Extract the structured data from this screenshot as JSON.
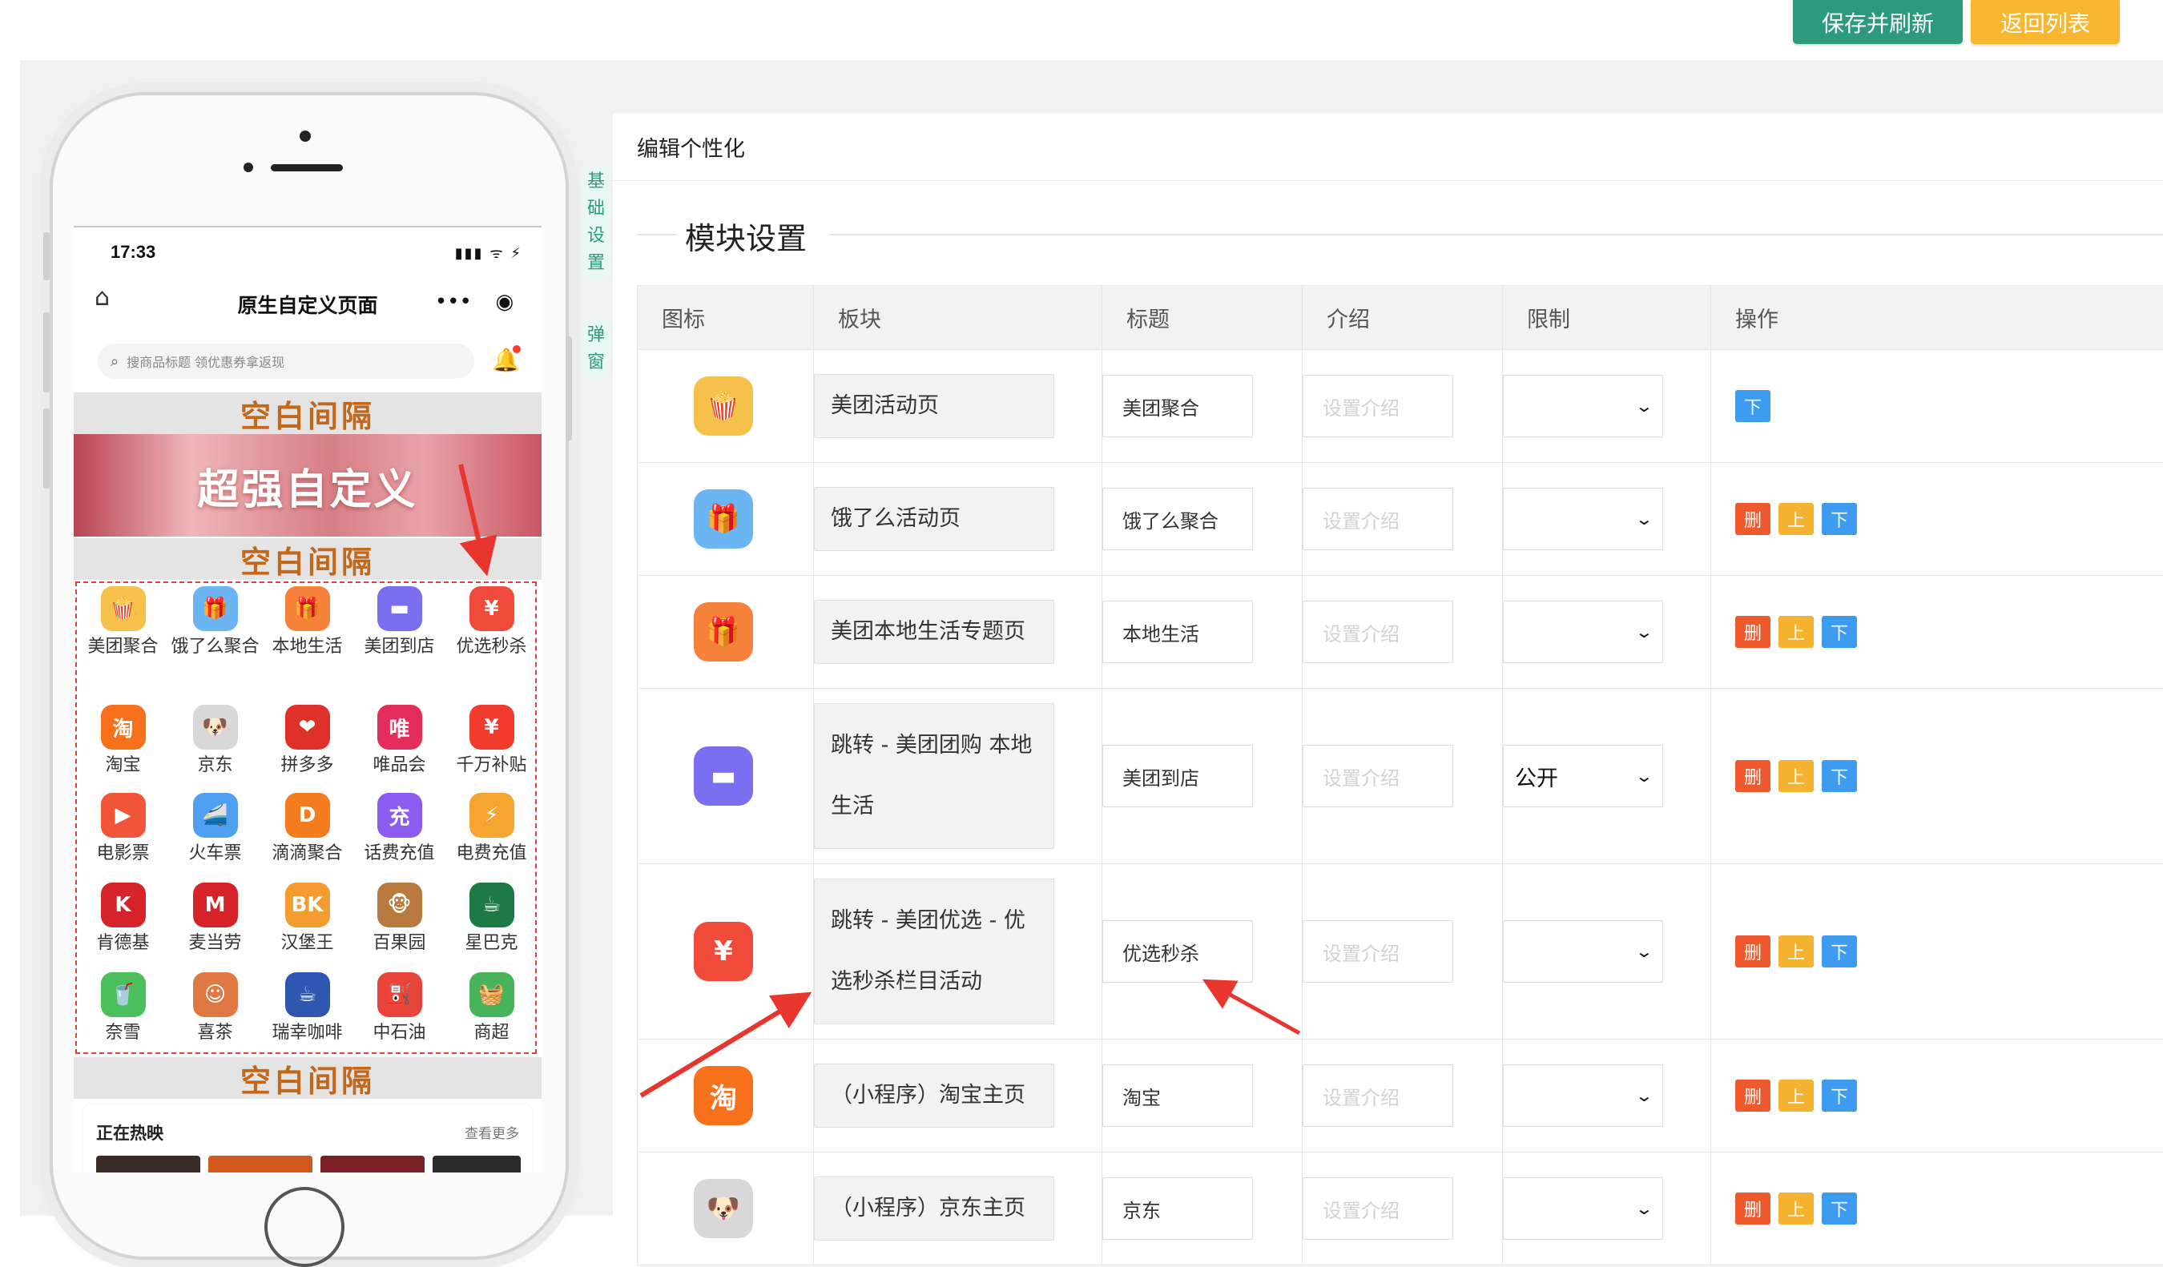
{
  "toolbar": {
    "save_label": "保存并刷新",
    "back_label": "返回列表"
  },
  "phone": {
    "time": "17:33",
    "status_icons": "▮▮▮ ᯤ ⚡",
    "nav_title": "原生自定义页面",
    "nav_more": "•••",
    "search_placeholder": "搜商品标题 领优惠券拿返现",
    "spacer_label": "空白间隔",
    "banner_text": "超强自定义",
    "grid": [
      [
        {
          "label": "美团聚合",
          "icon": "popcorn-icon",
          "color": "#f6c14a",
          "glyph": "🍿"
        },
        {
          "label": "饿了么聚合",
          "icon": "gift-box-icon",
          "color": "#6cb5f3",
          "glyph": "🎁"
        },
        {
          "label": "本地生活",
          "icon": "gift-icon",
          "color": "#f5813a",
          "glyph": "🎁"
        },
        {
          "label": "美团到店",
          "icon": "card-icon",
          "color": "#7a6ff0",
          "glyph": "▬"
        },
        {
          "label": "优选秒杀",
          "icon": "lucky-bag-icon",
          "color": "#f04b3a",
          "glyph": "¥"
        }
      ],
      [
        {
          "label": "淘宝",
          "icon": "taobao-icon",
          "color": "#f7701c",
          "glyph": "淘"
        },
        {
          "label": "京东",
          "icon": "jd-dog-icon",
          "color": "#d8d8d8",
          "glyph": "🐶"
        },
        {
          "label": "拼多多",
          "icon": "pdd-icon",
          "color": "#e0302a",
          "glyph": "❤"
        },
        {
          "label": "唯品会",
          "icon": "vip-icon",
          "color": "#e52d5b",
          "glyph": "唯"
        },
        {
          "label": "千万补贴",
          "icon": "red-packet-icon",
          "color": "#f03b2d",
          "glyph": "¥"
        }
      ],
      [
        {
          "label": "电影票",
          "icon": "movie-icon",
          "color": "#f0553a",
          "glyph": "▶"
        },
        {
          "label": "火车票",
          "icon": "train-icon",
          "color": "#4fa0f0",
          "glyph": "🚄"
        },
        {
          "label": "滴滴聚合",
          "icon": "didi-icon",
          "color": "#f57b1f",
          "glyph": "D"
        },
        {
          "label": "话费充值",
          "icon": "phone-charge-icon",
          "color": "#8c5cf0",
          "glyph": "充"
        },
        {
          "label": "电费充值",
          "icon": "electricity-icon",
          "color": "#f7a531",
          "glyph": "⚡"
        }
      ],
      [
        {
          "label": "肯德基",
          "icon": "kfc-icon",
          "color": "#d6232a",
          "glyph": "K"
        },
        {
          "label": "麦当劳",
          "icon": "mcdonalds-icon",
          "color": "#d6232a",
          "glyph": "M"
        },
        {
          "label": "汉堡王",
          "icon": "burger-king-icon",
          "color": "#f39c2f",
          "glyph": "BK"
        },
        {
          "label": "百果园",
          "icon": "monkey-icon",
          "color": "#b87a3e",
          "glyph": "🐵"
        },
        {
          "label": "星巴克",
          "icon": "starbucks-icon",
          "color": "#1e7a45",
          "glyph": "☕"
        }
      ],
      [
        {
          "label": "奈雪",
          "icon": "naixue-icon",
          "color": "#4bbf5b",
          "glyph": "🥤"
        },
        {
          "label": "喜茶",
          "icon": "heytea-icon",
          "color": "#e07843",
          "glyph": "☺"
        },
        {
          "label": "瑞幸咖啡",
          "icon": "luckin-icon",
          "color": "#2f56b0",
          "glyph": "☕"
        },
        {
          "label": "中石油",
          "icon": "petrochina-icon",
          "color": "#e9443a",
          "glyph": "⛽"
        },
        {
          "label": "商超",
          "icon": "basket-icon",
          "color": "#47b35a",
          "glyph": "🧺"
        }
      ]
    ],
    "movie_title": "正在热映",
    "movie_more": "查看更多"
  },
  "tabs": {
    "basic": [
      "基",
      "础",
      "设",
      "置"
    ],
    "popup": [
      "弹",
      "窗"
    ]
  },
  "panel": {
    "heading": "编辑个性化",
    "legend": "模块设置",
    "columns": [
      "图标",
      "板块",
      "标题",
      "介绍",
      "限制",
      "操作"
    ],
    "intro_placeholder": "设置介绍",
    "op_labels": {
      "delete": "删",
      "up": "上",
      "down": "下"
    },
    "rows": [
      {
        "icon": "popcorn-icon",
        "color": "#f6c14a",
        "glyph": "🍿",
        "block": "美团活动页",
        "title": "美团聚合",
        "limit": "",
        "ops": [
          "down"
        ]
      },
      {
        "icon": "gift-box-icon",
        "color": "#6cb5f3",
        "glyph": "🎁",
        "block": "饿了么活动页",
        "title": "饿了么聚合",
        "limit": "",
        "ops": [
          "delete",
          "up",
          "down"
        ]
      },
      {
        "icon": "gift-icon",
        "color": "#f5813a",
        "glyph": "🎁",
        "block": "美团本地生活专题页",
        "title": "本地生活",
        "limit": "",
        "ops": [
          "delete",
          "up",
          "down"
        ]
      },
      {
        "icon": "card-icon",
        "color": "#7a6ff0",
        "glyph": "▬",
        "block": "跳转 - 美团团购 本地生活",
        "title": "美团到店",
        "limit": "公开",
        "ops": [
          "delete",
          "up",
          "down"
        ]
      },
      {
        "icon": "lucky-bag-icon",
        "color": "#f04b3a",
        "glyph": "¥",
        "block": "跳转 - 美团优选 - 优选秒杀栏目活动",
        "title": "优选秒杀",
        "limit": "",
        "ops": [
          "delete",
          "up",
          "down"
        ]
      },
      {
        "icon": "taobao-icon",
        "color": "#f7701c",
        "glyph": "淘",
        "block": "（小程序）淘宝主页",
        "title": "淘宝",
        "limit": "",
        "ops": [
          "delete",
          "up",
          "down"
        ]
      },
      {
        "icon": "jd-dog-icon",
        "color": "#d8d8d8",
        "glyph": "🐶",
        "block": "（小程序）京东主页",
        "title": "京东",
        "limit": "",
        "ops": [
          "delete",
          "up",
          "down"
        ]
      }
    ]
  }
}
